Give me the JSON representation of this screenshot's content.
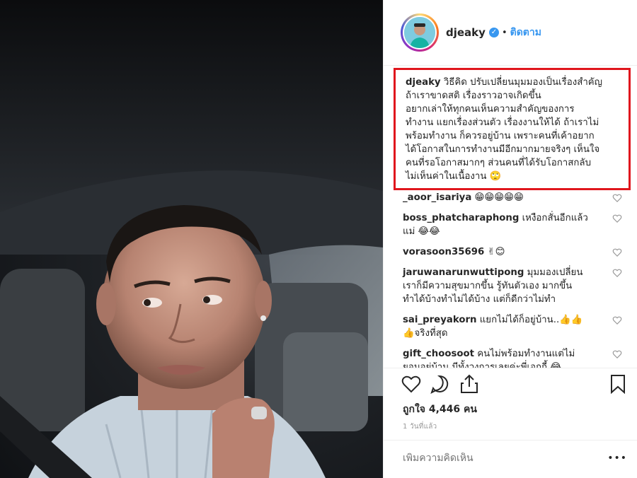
{
  "post": {
    "username": "djeaky",
    "verified_icon": "check-icon",
    "follow_label": "ติดตาม",
    "caption_user": "djeaky",
    "caption_lines": [
      "วิธีคิด ปรับเปลี่ยนมุมมองเป็นเรื่องสำคัญ",
      "ถ้าเราขาดสติ เรื่องราวอาจเกิดขึ้น",
      "อยากเล่าให้ทุกคนเห็นความสำคัญของการ",
      "ทำงาน แยกเรื่องส่วนตัว เรื่องงานให้ได้ ถ้าเราไม่",
      "พร้อมทำงาน ก็ควรอยู่บ้าน เพราะคนที่เค้าอยาก",
      "ได้โอกาสในการทำงานมีอีกมากมายจริงๆ เห็นใจ",
      "คนที่รอโอกาสมากๆ ส่วนคนที่ได้รับโอกาสกลับ",
      "ไม่เห็นค่าในเนื้องาน 🙄"
    ],
    "likes_text": "ถูกใจ 4,446 คน",
    "time_ago": "1 วันที่แล้ว",
    "comment_placeholder": "เพิ่มความคิดเห็น",
    "more_label": "•••"
  },
  "comments": [
    {
      "user": "_aoor_isariya",
      "lines": [
        " 😁😁😁😁😁"
      ]
    },
    {
      "user": "boss_phatcharaphong",
      "lines": [
        " เหงือกสั่นอีกแล้ว",
        "แม่ 😂😂"
      ]
    },
    {
      "user": "vorasoon35696",
      "lines": [
        " ✌😊"
      ]
    },
    {
      "user": "jaruwanarunwuttipong",
      "lines": [
        " มุมมองเปลี่ยน",
        "เราก็มีความสุขมากขึ้น รู้ทันตัวเอง มากขึ้น",
        "ทำได้บ้างทำไม่ได้บ้าง แต่ก็ดีกว่าไม่ทำ"
      ]
    },
    {
      "user": "sai_preyakorn",
      "lines": [
        " แยกไม่ได้ก็อยู่บ้าน..👍👍",
        "👍จริงที่สุด"
      ]
    },
    {
      "user": "gift_choosoot",
      "lines": [
        " คนไม่พร้อมทำงานแต่ไม่",
        "ยอมอยู่บ้าน มีทั้งวงการเลยค่ะพี่เอกกี้ 😂"
      ]
    }
  ],
  "icons": {
    "like": "heart-icon",
    "comment": "comment-icon",
    "share": "share-icon",
    "save": "bookmark-icon",
    "comment_like": "heart-icon"
  },
  "colors": {
    "link_blue": "#3897f0",
    "highlight_red": "#e0161d",
    "text": "#262626",
    "muted": "#999999"
  }
}
